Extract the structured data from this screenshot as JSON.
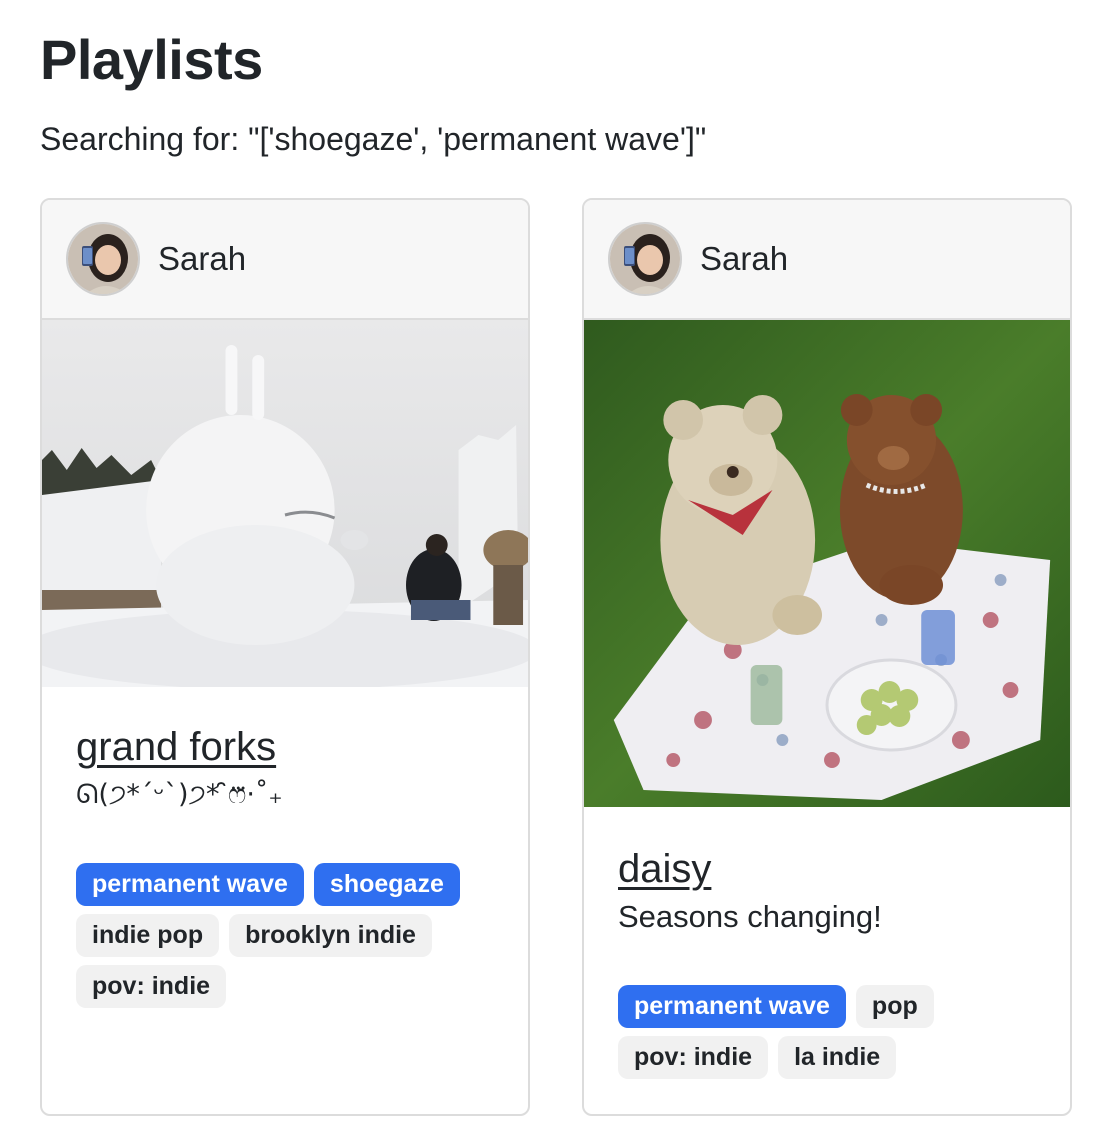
{
  "page": {
    "title": "Playlists",
    "search_text": "Searching for: \"['shoegaze', 'permanent wave']\""
  },
  "colors": {
    "accent_tag": "#2f6ff0",
    "plain_tag": "#f1f1f1",
    "card_border": "#dcdcdc",
    "header_bg": "#f7f7f7"
  },
  "playlists": [
    {
      "owner": "Sarah",
      "title": "grand forks",
      "description": "ᘏ(੭*ˊᵕˋ)੭* ̑̑ෆ⃛·˚₊",
      "tags": [
        {
          "label": "permanent wave",
          "matched": true
        },
        {
          "label": "shoegaze",
          "matched": true
        },
        {
          "label": "indie pop",
          "matched": false
        },
        {
          "label": "brooklyn indie",
          "matched": false
        },
        {
          "label": "pov: indie",
          "matched": false
        }
      ]
    },
    {
      "owner": "Sarah",
      "title": "daisy",
      "description": "Seasons changing!",
      "tags": [
        {
          "label": "permanent wave",
          "matched": true
        },
        {
          "label": "pop",
          "matched": false
        },
        {
          "label": "pov: indie",
          "matched": false
        },
        {
          "label": "la indie",
          "matched": false
        }
      ]
    }
  ]
}
